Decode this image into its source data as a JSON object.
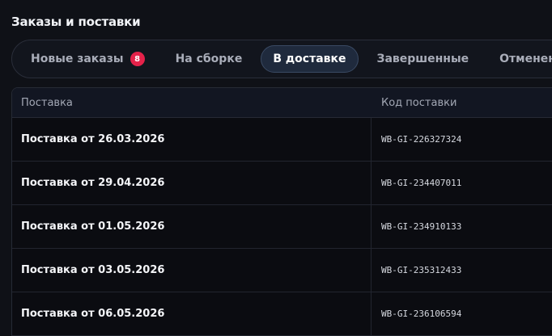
{
  "page": {
    "title": "Заказы и поставки"
  },
  "tabs": [
    {
      "label": "Новые заказы",
      "badge": "8",
      "active": false
    },
    {
      "label": "На сборке",
      "active": false
    },
    {
      "label": "В доставке",
      "active": true
    },
    {
      "label": "Завершенные",
      "active": false
    },
    {
      "label": "Отмененные",
      "active": false
    }
  ],
  "table": {
    "headers": {
      "supply": "Поставка",
      "code": "Код поставки"
    },
    "rows": [
      {
        "supply": "Поставка от 26.03.2026",
        "code": "WB-GI-226327324"
      },
      {
        "supply": "Поставка от 29.04.2026",
        "code": "WB-GI-234407011"
      },
      {
        "supply": "Поставка от 01.05.2026",
        "code": "WB-GI-234910133"
      },
      {
        "supply": "Поставка от 03.05.2026",
        "code": "WB-GI-235312433"
      },
      {
        "supply": "Поставка от 06.05.2026",
        "code": "WB-GI-236106594"
      }
    ]
  },
  "colors": {
    "accent_badge": "#e5224a",
    "active_tab_bg": "#1f2a3d",
    "background": "#0f1117"
  }
}
